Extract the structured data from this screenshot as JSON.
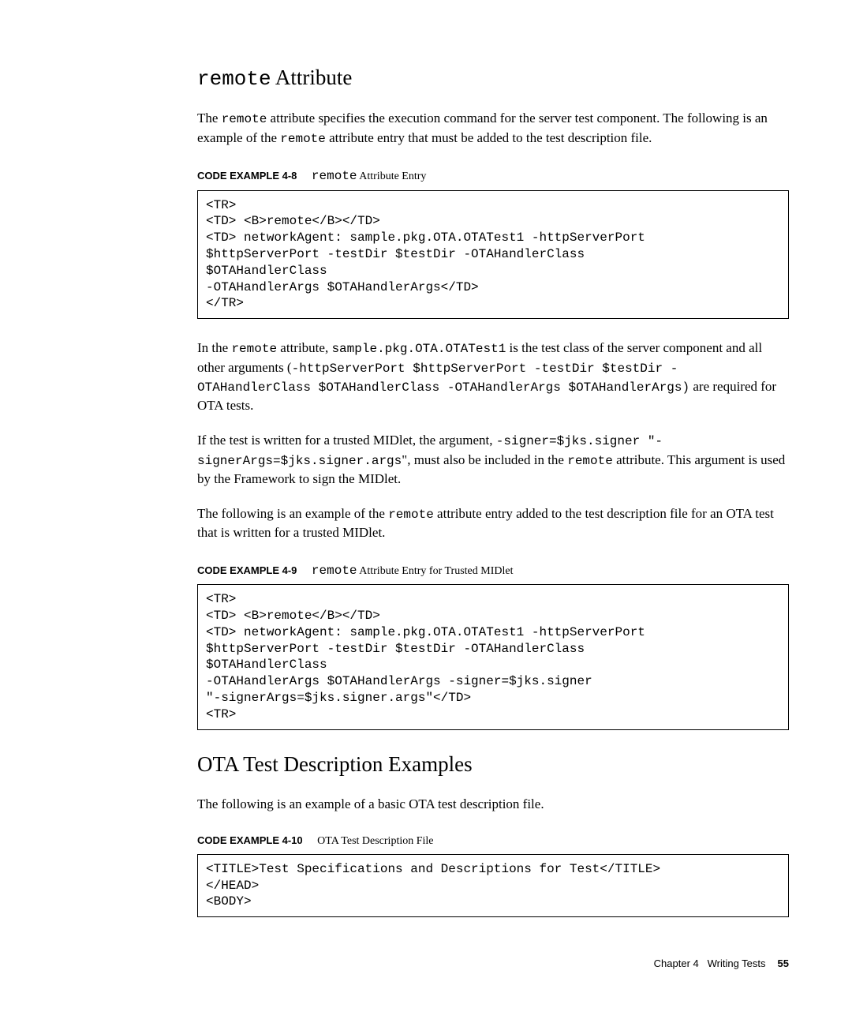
{
  "heading1": {
    "mono": "remote",
    "rest": " Attribute"
  },
  "para1": {
    "pre": "The ",
    "mono1": "remote",
    "mid": " attribute specifies the execution command for the server test component. The following is an example of the ",
    "mono2": "remote",
    "post": " attribute entry that must be added to the test description file."
  },
  "caption1": {
    "label": "CODE EXAMPLE 4-8",
    "mono": "remote",
    "rest": " Attribute Entry"
  },
  "code1": "<TR>\n<TD> <B>remote</B></TD>\n<TD> networkAgent: sample.pkg.OTA.OTATest1 -httpServerPort\n$httpServerPort -testDir $testDir -OTAHandlerClass\n$OTAHandlerClass\n-OTAHandlerArgs $OTAHandlerArgs</TD>\n</TR>",
  "para2": {
    "pre": "In the ",
    "m1": "remote",
    "t1": " attribute, ",
    "m2": "sample.pkg.OTA.OTATest1",
    "t2": " is the test class of the server component and all other arguments (",
    "m3": "-httpServerPort $httpServerPort -testDir $testDir -OTAHandlerClass $OTAHandlerClass -OTAHandlerArgs $OTAHandlerArgs)",
    "t3": " are required for OTA tests."
  },
  "para3": {
    "pre": "If the test is written for a trusted MIDlet, the argument, ",
    "m1": "-signer=$jks.signer \"-signerArgs=$jks.signer.args",
    "t1": "\", must also be included in the ",
    "m2": "remote",
    "t2": " attribute. This argument is used by the Framework to sign the MIDlet."
  },
  "para4": {
    "pre": "The following is an example of the ",
    "m1": "remote",
    "t1": " attribute entry added to the test description file for an OTA test that is written for a trusted MIDlet."
  },
  "caption2": {
    "label": "CODE EXAMPLE 4-9",
    "mono": "remote",
    "rest": " Attribute Entry for Trusted MIDlet"
  },
  "code2": "<TR>\n<TD> <B>remote</B></TD>\n<TD> networkAgent: sample.pkg.OTA.OTATest1 -httpServerPort\n$httpServerPort -testDir $testDir -OTAHandlerClass\n$OTAHandlerClass\n-OTAHandlerArgs $OTAHandlerArgs -signer=$jks.signer\n\"-signerArgs=$jks.signer.args\"</TD>\n<TR>",
  "heading2": "OTA Test Description Examples",
  "para5": "The following is an example of a basic OTA test description file.",
  "caption3": {
    "label": "CODE EXAMPLE 4-10",
    "rest": "OTA Test Description File"
  },
  "code3": "<TITLE>Test Specifications and Descriptions for Test</TITLE>\n</HEAD>\n<BODY>",
  "footer": {
    "chapter": "Chapter 4",
    "title": "Writing Tests",
    "page": "55"
  }
}
